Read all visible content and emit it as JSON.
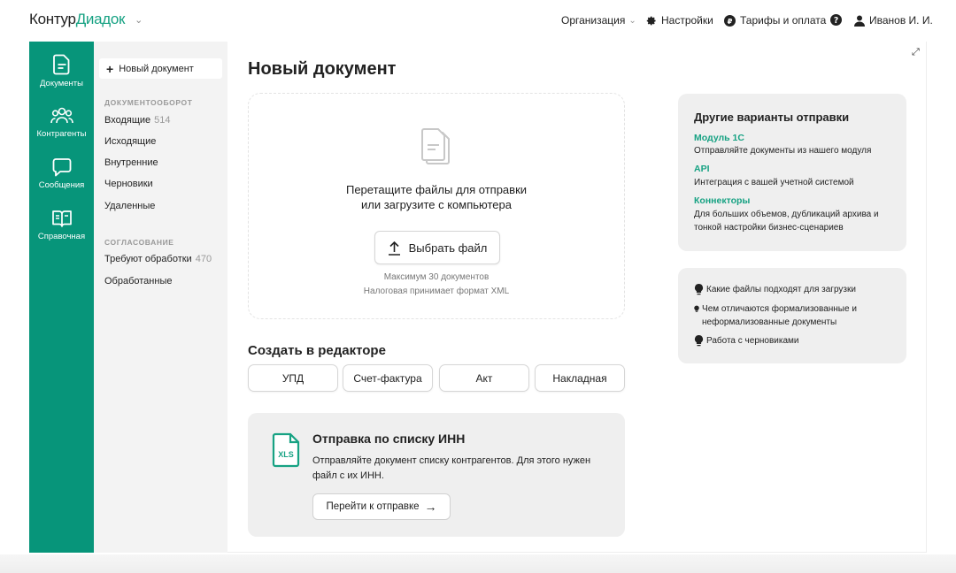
{
  "header": {
    "logo_part1": "Контур",
    "logo_part2": "Диадок",
    "logo_chevron": "⌄",
    "org": "Организация",
    "org_chevron": "⌄",
    "settings": "Настройки",
    "tariffs": "Тарифы и оплата",
    "user": "Иванов И. И."
  },
  "rail": {
    "items": [
      {
        "label": "Документы",
        "icon": "document-icon"
      },
      {
        "label": "Контрагенты",
        "icon": "people-icon"
      },
      {
        "label": "Сообщения",
        "icon": "chat-icon"
      },
      {
        "label": "Справочная",
        "icon": "book-icon"
      }
    ]
  },
  "sidebar": {
    "new_doc": "Новый документ",
    "section1": "ДОКУМЕНТООБОРОТ",
    "items1": [
      {
        "label": "Входящие",
        "count": "514"
      },
      {
        "label": "Исходящие"
      },
      {
        "label": "Внутренние"
      },
      {
        "label": "Черновики"
      },
      {
        "label": "Удаленные"
      }
    ],
    "section2": "СОГЛАСОВАНИЕ",
    "items2": [
      {
        "label": "Требуют обработки",
        "count": "470"
      },
      {
        "label": "Обработанные"
      }
    ]
  },
  "main": {
    "title": "Новый документ",
    "drop_line1": "Перетащите файлы для отправки",
    "drop_line2": "или загрузите с компьютера",
    "pick_button": "Выбрать файл",
    "note1": "Максимум 30 документов",
    "note2": "Налоговая принимает формат XML",
    "editor_title": "Создать в редакторе",
    "editor_buttons": [
      "УПД",
      "Счет-фактура",
      "Акт",
      "Накладная"
    ],
    "inn_title": "Отправка по списку ИНН",
    "inn_text": "Отправляйте документ списку контрагентов. Для этого нужен файл с их ИНН.",
    "inn_button": "Перейти к отправке",
    "inn_arrow": "→",
    "xls_label": "XLS"
  },
  "right": {
    "title": "Другие варианты отправки",
    "options": [
      {
        "link": "Модуль 1С",
        "desc": "Отправляйте документы из нашего модуля"
      },
      {
        "link": "API",
        "desc": "Интеграция с вашей учетной системой"
      },
      {
        "link": "Коннекторы",
        "desc": "Для больших объемов, дубликаций архива и тонкой настройки бизнес-сценариев"
      }
    ],
    "tips": [
      "Какие файлы подходят для загрузки",
      "Чем отличаются формализованные и неформализованные документы",
      "Работа с черновиками"
    ]
  },
  "colors": {
    "brand_green": "#07957a",
    "link_green": "#17a283"
  }
}
